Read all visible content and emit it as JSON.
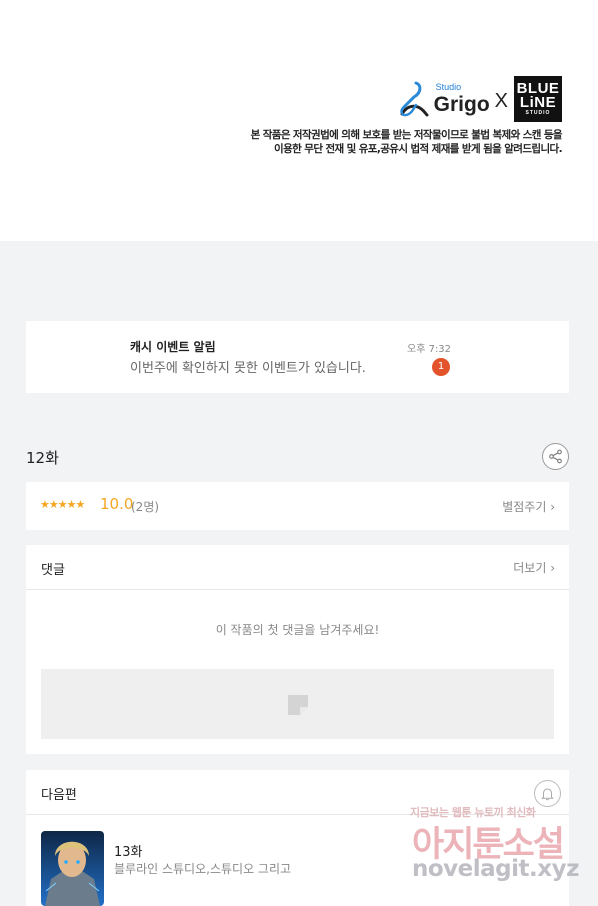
{
  "banner": {
    "studio_label": "Studio",
    "studio_name": "Grigo",
    "collab_mark": "X",
    "partner_line1": "BLUE",
    "partner_line2": "LiNE",
    "partner_line3": "STUDIO",
    "copyright_line1": "본 작품은 저작권법에 의해 보호를 받는 저작물이므로 불법 복제와 스캔 등을",
    "copyright_line2": "이용한 무단 전재 및 유포,공유시 법적 제재를 받게 됨을 알려드립니다."
  },
  "notification": {
    "title": "캐시 이벤트 알림",
    "message": "이번주에 확인하지 못한 이벤트가 있습니다.",
    "time": "오후 7:32",
    "badge_count": "1",
    "badge_color": "#e2532b"
  },
  "episode": {
    "title": "12화",
    "share_icon": "share-icon"
  },
  "rating": {
    "stars": "★★★★★",
    "score": "10.0",
    "count": "(2명)",
    "rate_link": "별점주기 ›",
    "star_color": "#f5a623"
  },
  "comments": {
    "title": "댓글",
    "more_link": "더보기 ›",
    "empty_message": "이 작품의 첫 댓글을 남겨주세요!"
  },
  "next_episode": {
    "section_title": "다음편",
    "episode_title": "13화",
    "authors": "블루라인 스튜디오,스튜디오 그리고",
    "bell_icon": "bell-icon"
  },
  "watermark": {
    "top_text": "지금보는 웹툰 뉴토끼 최신화",
    "main_text": "아지툰소설",
    "url_text": "novelagit.xyz"
  }
}
